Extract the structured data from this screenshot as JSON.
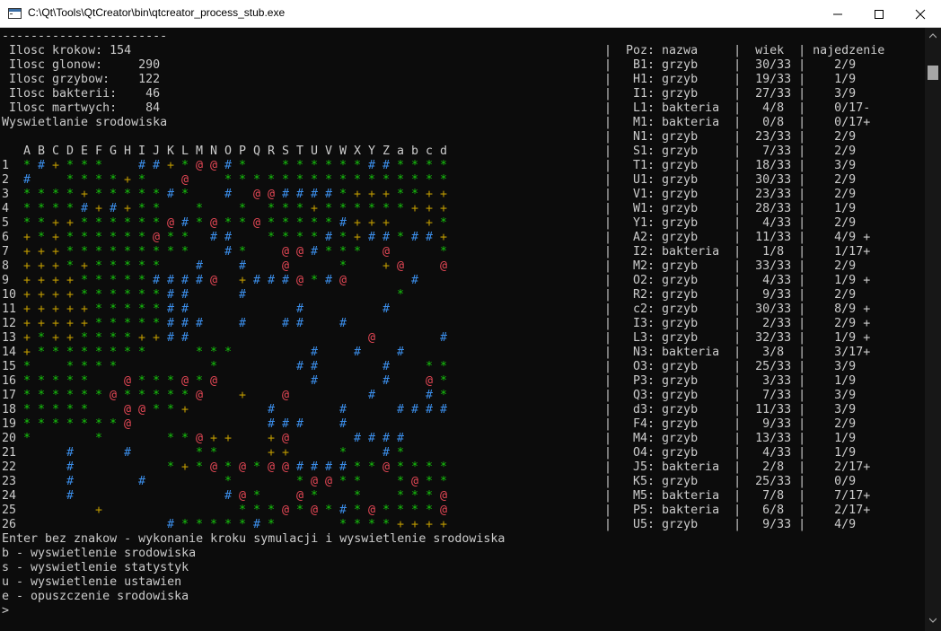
{
  "window": {
    "title": "C:\\Qt\\Tools\\QtCreator\\bin\\qtcreator_process_stub.exe"
  },
  "console": {
    "lines": [
      "-----------------------",
      " Ilosc krokow: 154",
      " Ilosc glonow:     290",
      " Ilosc grzybow:    122",
      " Ilosc bakterii:    46",
      " Ilosc martwych:    84",
      "Wyswietlanie srodowiska"
    ],
    "grid_header": [
      "A",
      "B",
      "C",
      "D",
      "E",
      "F",
      "G",
      "H",
      "I",
      "J",
      "K",
      "L",
      "M",
      "N",
      "O",
      "P",
      "Q",
      "R",
      "S",
      "T",
      "U",
      "V",
      "W",
      "X",
      "Y",
      "Z",
      "a",
      "b",
      "c",
      "d"
    ],
    "grid_rows": [
      "*#+***  ##+*@@#*  ******##****+*",
      "#  ****+*  @  ****************** ",
      "****+*****#*  # @@####*+++**+++ *#",
      "****#+#+**  *  * ***+******++++**",
      "**++******@#*@**@*****#+++  +** ",
      "+*+******@** ##  ****#*+##*##+#",
      "+++*********  #*  @@#*** @   ***+",
      "+++*+*****  #  #  @   *  +@  @#*#  **",
      "++++*****####@ +###@*#@    #  ***",
      "++++******##   #          *     @",
      "+++++*****##       #     #    + ###@+",
      "+++++*****###  #  ##  #          ++",
      "+*++****++##            @    #      #",
      "+********   ***     #  #  #   #  ##",
      "*  ****      *     ##    #  *****",
      "*****  @***@*@      #    #  @*****",
      "******@*****@  +  @     #   #***+*",
      "*****  @@**+     #    #   ####  @++++",
      "*******@         ###  #         +",
      "*    *    **@++  +@    ####   #####",
      "   #   #    **   ++   *  #*     #*###@",
      "   #      *+*@*@*@@####**@*****  @ *",
      "   #    #     *    *@@**  *@****   #*@",
      "   #          #@*  @*  *  ***@****@*",
      "     +         ***@*@*#*@****@*+*+*",
      "          #*****#*    ****+++++*+"
    ],
    "footer": [
      "Enter bez znakow - wykonanie kroku symulacji i wyswietlenie srodowiska",
      "b - wyswietlenie srodowiska",
      "s - wyswietlenie statystyk",
      "u - wyswietlenie ustawien",
      "e - opuszczenie srodowiska",
      ">"
    ],
    "table": {
      "header": "|  Poz: nazwa     |  wiek  | najedzenie",
      "rows": [
        "|   B1: grzyb     |  30/33 |    2/9",
        "|   H1: grzyb     |  19/33 |    1/9",
        "|   I1: grzyb     |  27/33 |    3/9",
        "|   L1: bakteria  |   4/8  |    0/17-",
        "|   M1: bakteria  |   0/8  |    0/17+",
        "|   N1: grzyb     |  23/33 |    2/9",
        "|   S1: grzyb     |   7/33 |    2/9",
        "|   T1: grzyb     |  18/33 |    3/9",
        "|   U1: grzyb     |  30/33 |    2/9",
        "|   V1: grzyb     |  23/33 |    2/9",
        "|   W1: grzyb     |  28/33 |    1/9",
        "|   Y1: grzyb     |   4/33 |    2/9",
        "|   A2: grzyb     |  11/33 |    4/9 +",
        "|   I2: bakteria  |   1/8  |    1/17+",
        "|   M2: grzyb     |  33/33 |    2/9",
        "|   O2: grzyb     |   4/33 |    1/9 +",
        "|   R2: grzyb     |   9/33 |    2/9",
        "|   c2: grzyb     |  30/33 |    8/9 +",
        "|   I3: grzyb     |   2/33 |    2/9 +",
        "|   L3: grzyb     |  32/33 |    1/9 +",
        "|   N3: bakteria  |   3/8  |    3/17+",
        "|   O3: grzyb     |  25/33 |    3/9",
        "|   P3: grzyb     |   3/33 |    1/9",
        "|   Q3: grzyb     |   7/33 |    3/9",
        "|   d3: grzyb     |  11/33 |    3/9",
        "|   F4: grzyb     |   9/33 |    2/9",
        "|   M4: grzyb     |  13/33 |    1/9",
        "|   O4: grzyb     |   4/33 |    1/9",
        "|   J5: bakteria  |   2/8  |    2/17+",
        "|   K5: grzyb     |  25/33 |    0/9",
        "|   M5: bakteria  |   7/8  |    7/17+",
        "|   P5: bakteria  |   6/8  |    2/17+",
        "|   U5: grzyb     |   9/33 |    4/9"
      ]
    },
    "colors": {
      "hash": "#3b8eea",
      "star": "#16c60c",
      "plus": "#c19c00",
      "at": "#e74856",
      "text": "#cccccc",
      "bg": "#0c0c0c"
    }
  },
  "icons": {
    "app": "console-icon",
    "minimize": "minimize-icon",
    "maximize": "maximize-icon",
    "close": "close-icon"
  }
}
